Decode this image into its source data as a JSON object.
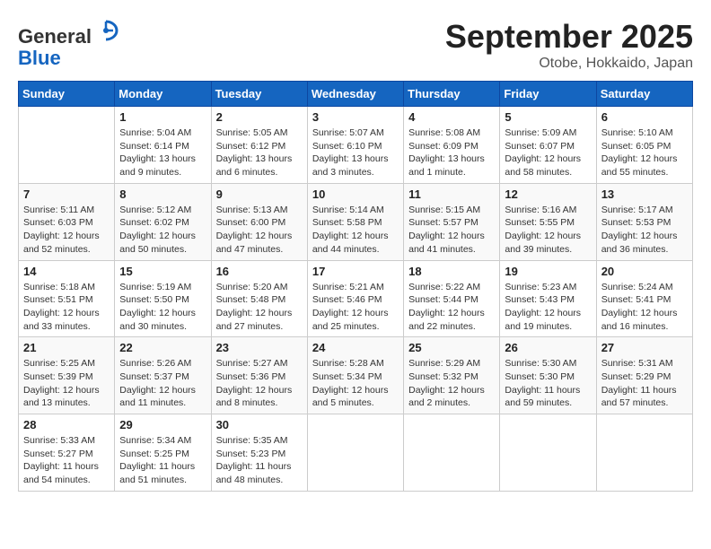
{
  "header": {
    "logo_line1": "General",
    "logo_line2": "Blue",
    "month_title": "September 2025",
    "location": "Otobe, Hokkaido, Japan"
  },
  "weekdays": [
    "Sunday",
    "Monday",
    "Tuesday",
    "Wednesday",
    "Thursday",
    "Friday",
    "Saturday"
  ],
  "weeks": [
    [
      {
        "day": "",
        "sunrise": "",
        "sunset": "",
        "daylight": ""
      },
      {
        "day": "1",
        "sunrise": "Sunrise: 5:04 AM",
        "sunset": "Sunset: 6:14 PM",
        "daylight": "Daylight: 13 hours and 9 minutes."
      },
      {
        "day": "2",
        "sunrise": "Sunrise: 5:05 AM",
        "sunset": "Sunset: 6:12 PM",
        "daylight": "Daylight: 13 hours and 6 minutes."
      },
      {
        "day": "3",
        "sunrise": "Sunrise: 5:07 AM",
        "sunset": "Sunset: 6:10 PM",
        "daylight": "Daylight: 13 hours and 3 minutes."
      },
      {
        "day": "4",
        "sunrise": "Sunrise: 5:08 AM",
        "sunset": "Sunset: 6:09 PM",
        "daylight": "Daylight: 13 hours and 1 minute."
      },
      {
        "day": "5",
        "sunrise": "Sunrise: 5:09 AM",
        "sunset": "Sunset: 6:07 PM",
        "daylight": "Daylight: 12 hours and 58 minutes."
      },
      {
        "day": "6",
        "sunrise": "Sunrise: 5:10 AM",
        "sunset": "Sunset: 6:05 PM",
        "daylight": "Daylight: 12 hours and 55 minutes."
      }
    ],
    [
      {
        "day": "7",
        "sunrise": "Sunrise: 5:11 AM",
        "sunset": "Sunset: 6:03 PM",
        "daylight": "Daylight: 12 hours and 52 minutes."
      },
      {
        "day": "8",
        "sunrise": "Sunrise: 5:12 AM",
        "sunset": "Sunset: 6:02 PM",
        "daylight": "Daylight: 12 hours and 50 minutes."
      },
      {
        "day": "9",
        "sunrise": "Sunrise: 5:13 AM",
        "sunset": "Sunset: 6:00 PM",
        "daylight": "Daylight: 12 hours and 47 minutes."
      },
      {
        "day": "10",
        "sunrise": "Sunrise: 5:14 AM",
        "sunset": "Sunset: 5:58 PM",
        "daylight": "Daylight: 12 hours and 44 minutes."
      },
      {
        "day": "11",
        "sunrise": "Sunrise: 5:15 AM",
        "sunset": "Sunset: 5:57 PM",
        "daylight": "Daylight: 12 hours and 41 minutes."
      },
      {
        "day": "12",
        "sunrise": "Sunrise: 5:16 AM",
        "sunset": "Sunset: 5:55 PM",
        "daylight": "Daylight: 12 hours and 39 minutes."
      },
      {
        "day": "13",
        "sunrise": "Sunrise: 5:17 AM",
        "sunset": "Sunset: 5:53 PM",
        "daylight": "Daylight: 12 hours and 36 minutes."
      }
    ],
    [
      {
        "day": "14",
        "sunrise": "Sunrise: 5:18 AM",
        "sunset": "Sunset: 5:51 PM",
        "daylight": "Daylight: 12 hours and 33 minutes."
      },
      {
        "day": "15",
        "sunrise": "Sunrise: 5:19 AM",
        "sunset": "Sunset: 5:50 PM",
        "daylight": "Daylight: 12 hours and 30 minutes."
      },
      {
        "day": "16",
        "sunrise": "Sunrise: 5:20 AM",
        "sunset": "Sunset: 5:48 PM",
        "daylight": "Daylight: 12 hours and 27 minutes."
      },
      {
        "day": "17",
        "sunrise": "Sunrise: 5:21 AM",
        "sunset": "Sunset: 5:46 PM",
        "daylight": "Daylight: 12 hours and 25 minutes."
      },
      {
        "day": "18",
        "sunrise": "Sunrise: 5:22 AM",
        "sunset": "Sunset: 5:44 PM",
        "daylight": "Daylight: 12 hours and 22 minutes."
      },
      {
        "day": "19",
        "sunrise": "Sunrise: 5:23 AM",
        "sunset": "Sunset: 5:43 PM",
        "daylight": "Daylight: 12 hours and 19 minutes."
      },
      {
        "day": "20",
        "sunrise": "Sunrise: 5:24 AM",
        "sunset": "Sunset: 5:41 PM",
        "daylight": "Daylight: 12 hours and 16 minutes."
      }
    ],
    [
      {
        "day": "21",
        "sunrise": "Sunrise: 5:25 AM",
        "sunset": "Sunset: 5:39 PM",
        "daylight": "Daylight: 12 hours and 13 minutes."
      },
      {
        "day": "22",
        "sunrise": "Sunrise: 5:26 AM",
        "sunset": "Sunset: 5:37 PM",
        "daylight": "Daylight: 12 hours and 11 minutes."
      },
      {
        "day": "23",
        "sunrise": "Sunrise: 5:27 AM",
        "sunset": "Sunset: 5:36 PM",
        "daylight": "Daylight: 12 hours and 8 minutes."
      },
      {
        "day": "24",
        "sunrise": "Sunrise: 5:28 AM",
        "sunset": "Sunset: 5:34 PM",
        "daylight": "Daylight: 12 hours and 5 minutes."
      },
      {
        "day": "25",
        "sunrise": "Sunrise: 5:29 AM",
        "sunset": "Sunset: 5:32 PM",
        "daylight": "Daylight: 12 hours and 2 minutes."
      },
      {
        "day": "26",
        "sunrise": "Sunrise: 5:30 AM",
        "sunset": "Sunset: 5:30 PM",
        "daylight": "Daylight: 11 hours and 59 minutes."
      },
      {
        "day": "27",
        "sunrise": "Sunrise: 5:31 AM",
        "sunset": "Sunset: 5:29 PM",
        "daylight": "Daylight: 11 hours and 57 minutes."
      }
    ],
    [
      {
        "day": "28",
        "sunrise": "Sunrise: 5:33 AM",
        "sunset": "Sunset: 5:27 PM",
        "daylight": "Daylight: 11 hours and 54 minutes."
      },
      {
        "day": "29",
        "sunrise": "Sunrise: 5:34 AM",
        "sunset": "Sunset: 5:25 PM",
        "daylight": "Daylight: 11 hours and 51 minutes."
      },
      {
        "day": "30",
        "sunrise": "Sunrise: 5:35 AM",
        "sunset": "Sunset: 5:23 PM",
        "daylight": "Daylight: 11 hours and 48 minutes."
      },
      {
        "day": "",
        "sunrise": "",
        "sunset": "",
        "daylight": ""
      },
      {
        "day": "",
        "sunrise": "",
        "sunset": "",
        "daylight": ""
      },
      {
        "day": "",
        "sunrise": "",
        "sunset": "",
        "daylight": ""
      },
      {
        "day": "",
        "sunrise": "",
        "sunset": "",
        "daylight": ""
      }
    ]
  ]
}
